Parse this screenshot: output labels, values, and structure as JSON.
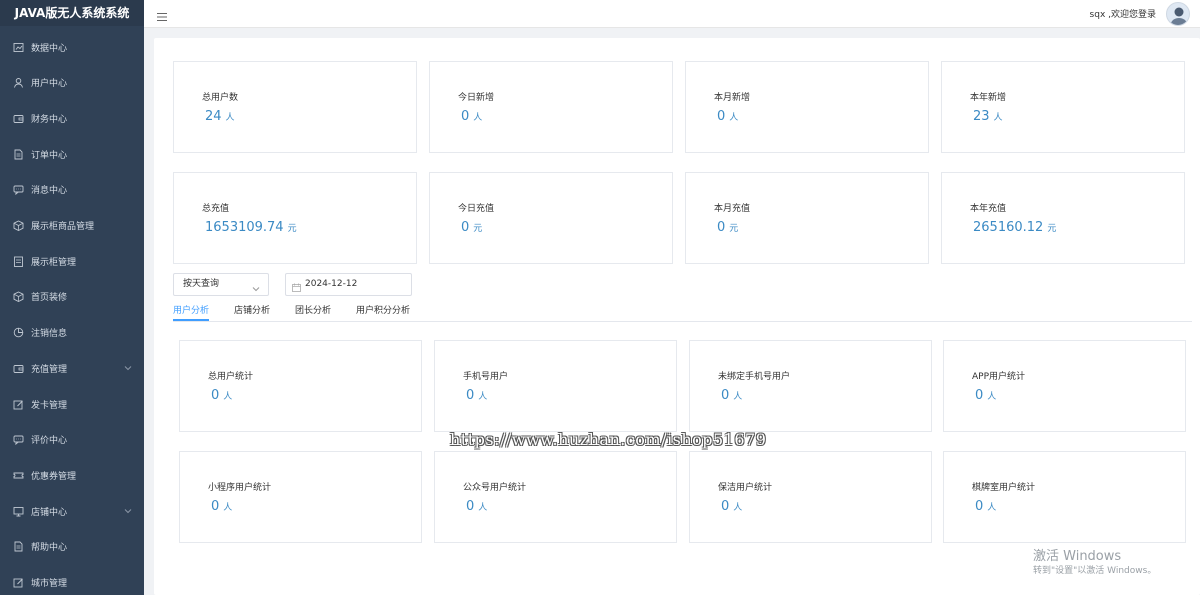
{
  "app": {
    "title": "JAVA版无人系统系统"
  },
  "header": {
    "welcome": "sqx ,欢迎您登录"
  },
  "sidebar": {
    "items": [
      {
        "label": "数据中心",
        "icon": "dashboard-icon",
        "chevron": false
      },
      {
        "label": "用户中心",
        "icon": "user-icon",
        "chevron": false
      },
      {
        "label": "财务中心",
        "icon": "wallet-icon",
        "chevron": false
      },
      {
        "label": "订单中心",
        "icon": "document-icon",
        "chevron": false
      },
      {
        "label": "消息中心",
        "icon": "message-icon",
        "chevron": false
      },
      {
        "label": "展示柜商品管理",
        "icon": "box-icon",
        "chevron": false
      },
      {
        "label": "展示柜管理",
        "icon": "cabinet-icon",
        "chevron": false
      },
      {
        "label": "首页装修",
        "icon": "box-icon",
        "chevron": false
      },
      {
        "label": "注销信息",
        "icon": "pie-icon",
        "chevron": false
      },
      {
        "label": "充值管理",
        "icon": "wallet-icon",
        "chevron": true
      },
      {
        "label": "发卡管理",
        "icon": "edit-icon",
        "chevron": false
      },
      {
        "label": "评价中心",
        "icon": "message-icon",
        "chevron": false
      },
      {
        "label": "优惠券管理",
        "icon": "coupon-icon",
        "chevron": false
      },
      {
        "label": "店铺中心",
        "icon": "monitor-icon",
        "chevron": true
      },
      {
        "label": "帮助中心",
        "icon": "document-icon",
        "chevron": false
      },
      {
        "label": "城市管理",
        "icon": "edit-icon",
        "chevron": false
      }
    ]
  },
  "stats_users": [
    {
      "title": "总用户数",
      "value": "24",
      "unit": "人"
    },
    {
      "title": "今日新增",
      "value": "0",
      "unit": "人"
    },
    {
      "title": "本月新增",
      "value": "0",
      "unit": "人"
    },
    {
      "title": "本年新增",
      "value": "23",
      "unit": "人"
    }
  ],
  "stats_recharge": [
    {
      "title": "总充值",
      "value": "1653109.74",
      "unit": "元"
    },
    {
      "title": "今日充值",
      "value": "0",
      "unit": "元"
    },
    {
      "title": "本月充值",
      "value": "0",
      "unit": "元"
    },
    {
      "title": "本年充值",
      "value": "265160.12",
      "unit": "元"
    }
  ],
  "filter": {
    "mode": "按天查询",
    "date": "2024-12-12"
  },
  "tabs": [
    {
      "label": "用户分析",
      "active": true
    },
    {
      "label": "店铺分析",
      "active": false
    },
    {
      "label": "团长分析",
      "active": false
    },
    {
      "label": "用户积分分析",
      "active": false
    }
  ],
  "analysis_row1": [
    {
      "title": "总用户统计",
      "value": "0",
      "unit": "人"
    },
    {
      "title": "手机号用户",
      "value": "0",
      "unit": "人"
    },
    {
      "title": "未绑定手机号用户",
      "value": "0",
      "unit": "人"
    },
    {
      "title": "APP用户统计",
      "value": "0",
      "unit": "人"
    }
  ],
  "analysis_row2": [
    {
      "title": "小程序用户统计",
      "value": "0",
      "unit": "人"
    },
    {
      "title": "公众号用户统计",
      "value": "0",
      "unit": "人"
    },
    {
      "title": "保洁用户统计",
      "value": "0",
      "unit": "人"
    },
    {
      "title": "棋牌室用户统计",
      "value": "0",
      "unit": "人"
    }
  ],
  "watermark": "https://www.huzhan.com/ishop51679",
  "os_notice": {
    "title": "激活 Windows",
    "subtitle": "转到\"设置\"以激活 Windows。"
  },
  "colors": {
    "sidebar": "#304156",
    "accent": "#409eff",
    "value": "#3b8ac4"
  }
}
